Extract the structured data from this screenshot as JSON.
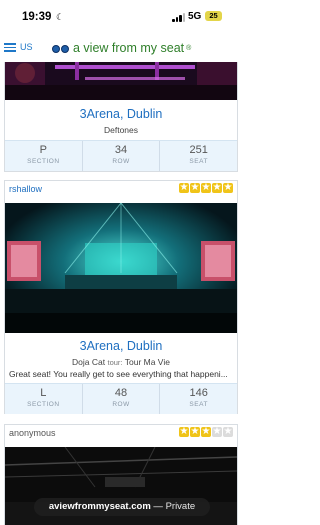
{
  "status_bar": {
    "time": "19:39",
    "network": "5G",
    "battery": "25"
  },
  "header": {
    "region": "US",
    "logo_text": "a view from my seat",
    "logo_mark": "®"
  },
  "reviews": [
    {
      "venue": "3Arena, Dublin",
      "event": "Deftones",
      "seat": {
        "section_value": "P",
        "row_value": "34",
        "seat_value": "251"
      }
    },
    {
      "username": "rshallow",
      "rating": 5,
      "venue": "3Arena, Dublin",
      "event": "Doja Cat",
      "tour_label": "tour:",
      "tour": "Tour Ma Vie",
      "comment": "Great seat! You really get to see everything that happeni...",
      "seat": {
        "section_value": "L",
        "row_value": "48",
        "seat_value": "146"
      }
    },
    {
      "username": "anonymous",
      "rating": 3
    }
  ],
  "seat_labels": {
    "section": "SECTION",
    "row": "ROW",
    "seat": "SEAT"
  },
  "url_pill": {
    "host": "aviewfrommyseat.com",
    "separator": " — ",
    "privacy": "Private"
  },
  "colors": {
    "link_blue": "#1f6fc0",
    "logo_green": "#2f7f2a",
    "star_gold": "#f0c419",
    "seat_bar": "#eaf4fc"
  }
}
